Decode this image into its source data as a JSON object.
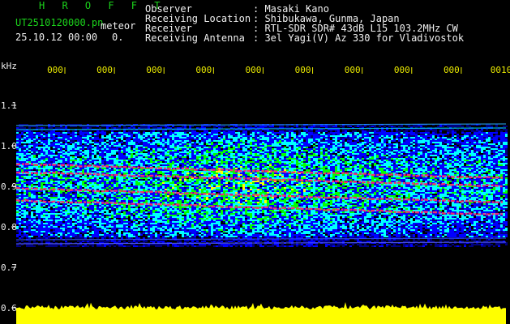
{
  "header": {
    "app_title": "H R O F F T",
    "filename": "UT2510120000.pn",
    "mode_label": "meteor",
    "datetime": "25.10.12 00:00",
    "count": "0.",
    "info": [
      {
        "label": "Observer",
        "value": "Masaki Kano"
      },
      {
        "label": "Receiving Location",
        "value": "Shibukawa, Gunma, Japan"
      },
      {
        "label": "Receiver",
        "value": "RTL-SDR SDR# 43dB L15 103.2MHz CW"
      },
      {
        "label": "Receiving Antenna",
        "value": "3el Yagi(V) Az 330 for Vladivostok"
      }
    ]
  },
  "colors": {
    "background": "#000000",
    "header_green": "#1bd21b",
    "header_white": "#f0f0f0",
    "tick_yellow": "#e8e800",
    "spectrum_yellow": "#ffff00",
    "hot_trace": "#ff2a6a"
  },
  "chart_data": {
    "type": "heatmap",
    "ylabel": "kHz",
    "y_ticks": [
      "1.1",
      "1.0",
      "0.9",
      "0.8",
      "0.7",
      "0.6"
    ],
    "y_tick_values": [
      1.1,
      1.0,
      0.9,
      0.8,
      0.7,
      0.6
    ],
    "ylim": [
      0.58,
      1.15
    ],
    "x_ticks": [
      "000",
      "000",
      "000",
      "000",
      "000",
      "000",
      "000",
      "000",
      "000",
      "0010"
    ],
    "colormap": [
      "#000080",
      "#0000ff",
      "#00ffff",
      "#00ff00",
      "#ffff00",
      "#ff0000",
      "#ff0080"
    ],
    "signal_band_khz": [
      0.76,
      1.05
    ],
    "traces": [
      {
        "start_khz": 0.955,
        "end_khz": 0.92
      },
      {
        "start_khz": 0.935,
        "end_khz": 0.9
      },
      {
        "start_khz": 0.865,
        "end_khz": 0.83
      },
      {
        "start_khz": 0.895,
        "end_khz": 0.86
      }
    ],
    "baseline_spectrum": "yellow"
  }
}
